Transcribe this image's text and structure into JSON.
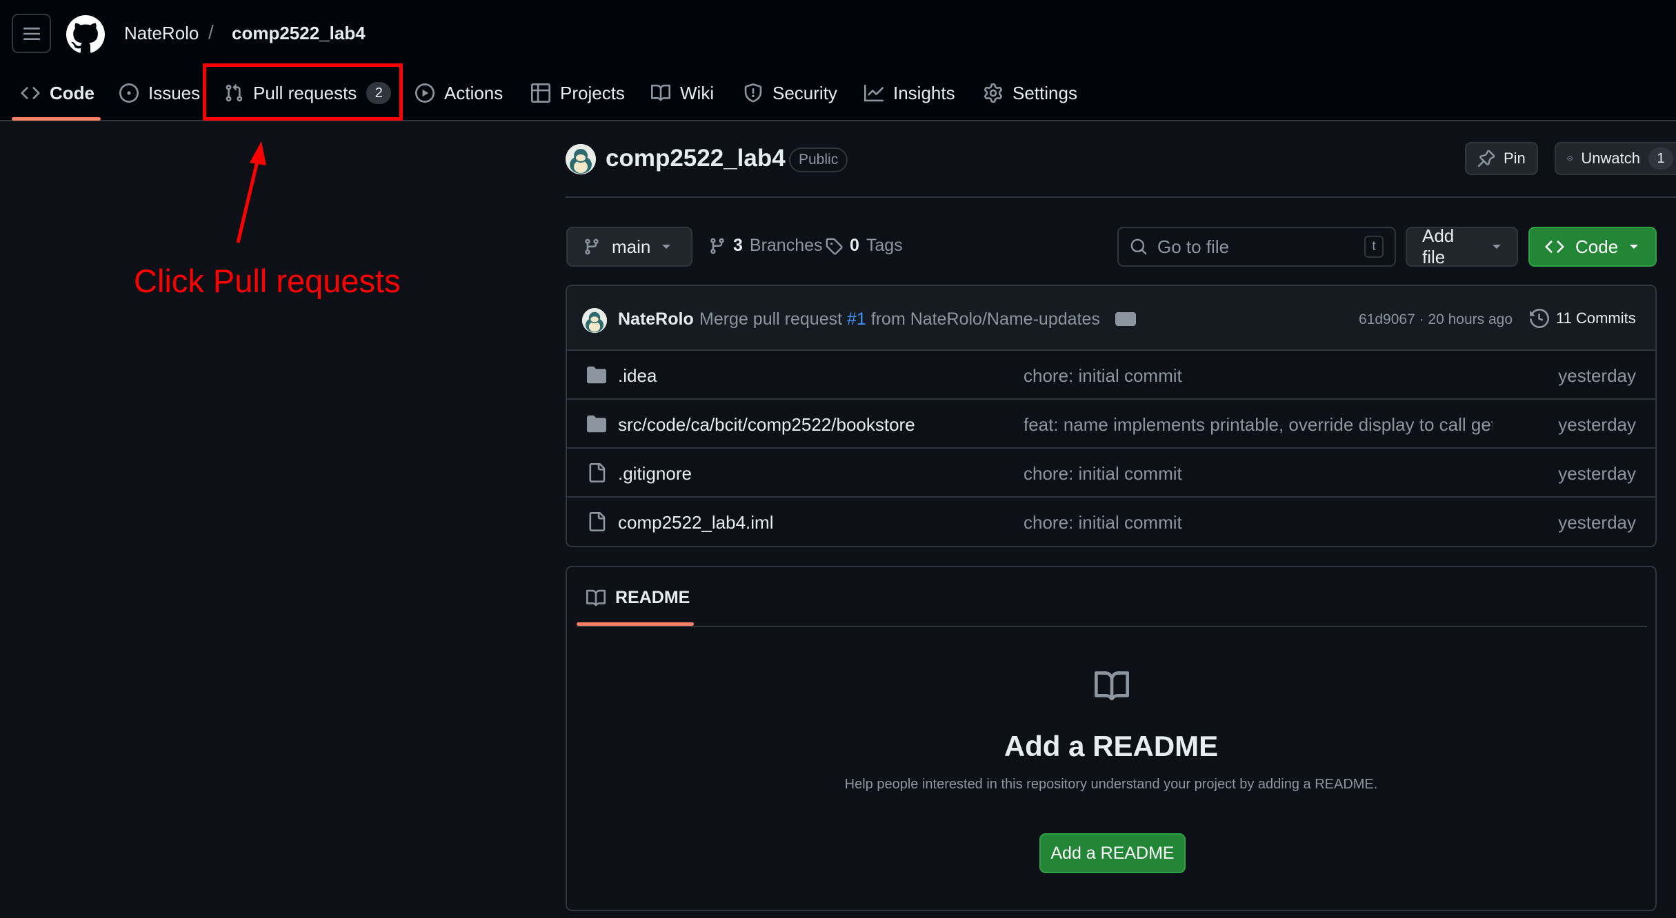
{
  "header": {
    "owner": "NateRolo",
    "separator": "/",
    "repo": "comp2522_lab4"
  },
  "tabs": [
    {
      "label": "Code",
      "icon": "code-icon"
    },
    {
      "label": "Issues",
      "icon": "issue-icon"
    },
    {
      "label": "Pull requests",
      "icon": "pull-request-icon",
      "count": "2"
    },
    {
      "label": "Actions",
      "icon": "play-icon"
    },
    {
      "label": "Projects",
      "icon": "table-icon"
    },
    {
      "label": "Wiki",
      "icon": "book-icon"
    },
    {
      "label": "Security",
      "icon": "shield-icon"
    },
    {
      "label": "Insights",
      "icon": "graph-icon"
    },
    {
      "label": "Settings",
      "icon": "gear-icon"
    }
  ],
  "annotation": {
    "text": "Click Pull requests",
    "color": "#ff0000"
  },
  "repo": {
    "title": "comp2522_lab4",
    "visibility": "Public",
    "pin_label": "Pin",
    "unwatch_label": "Unwatch",
    "watch_count": "1"
  },
  "toolbar": {
    "branch": "main",
    "branches_count": "3",
    "branches_label": "Branches",
    "tags_count": "0",
    "tags_label": "Tags",
    "gofile_placeholder": "Go to file",
    "gofile_key": "t",
    "add_file_label": "Add file",
    "code_label": "Code"
  },
  "commit": {
    "author": "NateRolo",
    "message_prefix": "Merge pull request",
    "pr_ref": "#1",
    "message_suffix": "from NateRolo/Name-updates",
    "hash_time": "61d9067 · 20 hours ago",
    "commits_label": "11 Commits"
  },
  "files": [
    {
      "name": ".idea",
      "type": "folder",
      "message": "chore: initial commit",
      "date": "yesterday"
    },
    {
      "name": "src/code/ca/bcit/comp2522/bookstore",
      "type": "folder",
      "message": "feat: name implements printable, override display to call get...",
      "date": "yesterday"
    },
    {
      "name": ".gitignore",
      "type": "file",
      "message": "chore: initial commit",
      "date": "yesterday"
    },
    {
      "name": "comp2522_lab4.iml",
      "type": "file",
      "message": "chore: initial commit",
      "date": "yesterday"
    }
  ],
  "readme": {
    "tab_label": "README",
    "heading": "Add a README",
    "description": "Help people interested in this repository understand your project by adding a README.",
    "button_label": "Add a README"
  },
  "colors": {
    "background": "#0d1117",
    "header_bg": "#010409",
    "accent_underline": "#f78166",
    "green_button": "#238636",
    "link_blue": "#4493f8"
  }
}
